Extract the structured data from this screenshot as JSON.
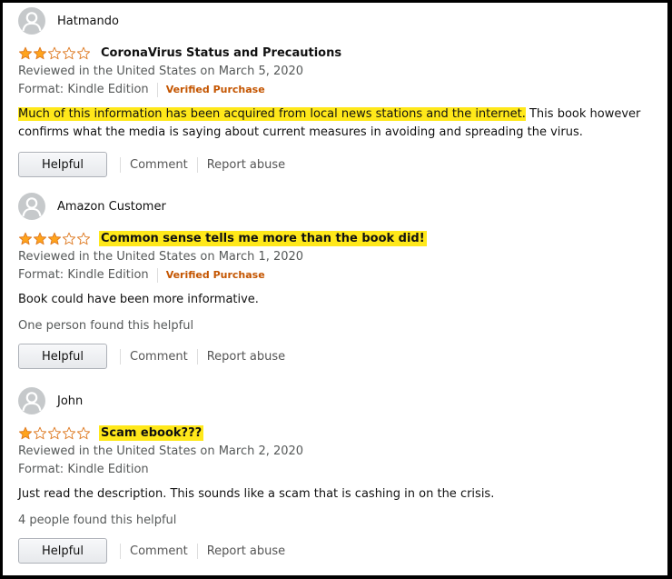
{
  "colors": {
    "star_filled": "#ffa41c",
    "star_outline": "#de7921",
    "highlight": "#ffe81a",
    "verified": "#c45500"
  },
  "reviews": [
    {
      "author": "Hatmando",
      "rating": 2,
      "max_rating": 5,
      "title": "CoronaVirus Status and Precautions",
      "title_highlighted": false,
      "date_line": "Reviewed in the United States on March 5, 2020",
      "format": "Format: Kindle Edition",
      "verified": "Verified Purchase",
      "body_highlight": "Much of this information has been acquired from local news stations and the internet.",
      "body_rest": " This book however confirms what the media is saying about current measures in avoiding and spreading the virus.",
      "helpful_count": "",
      "helpful_label": "Helpful",
      "comment_label": "Comment",
      "report_label": "Report abuse"
    },
    {
      "author": "Amazon Customer",
      "rating": 3,
      "max_rating": 5,
      "title": "Common sense tells me more than the book did!",
      "title_highlighted": true,
      "date_line": "Reviewed in the United States on March 1, 2020",
      "format": "Format: Kindle Edition",
      "verified": "Verified Purchase",
      "body_highlight": "",
      "body_rest": "Book could have been more informative.",
      "helpful_count": "One person found this helpful",
      "helpful_label": "Helpful",
      "comment_label": "Comment",
      "report_label": "Report abuse"
    },
    {
      "author": "John",
      "rating": 1,
      "max_rating": 5,
      "title": "Scam ebook???",
      "title_highlighted": true,
      "date_line": "Reviewed in the United States on March 2, 2020",
      "format": "Format: Kindle Edition",
      "verified": "",
      "body_highlight": "",
      "body_rest": "Just read the description. This sounds like a scam that is cashing in on the crisis.",
      "helpful_count": "4 people found this helpful",
      "helpful_label": "Helpful",
      "comment_label": "Comment",
      "report_label": "Report abuse"
    }
  ]
}
